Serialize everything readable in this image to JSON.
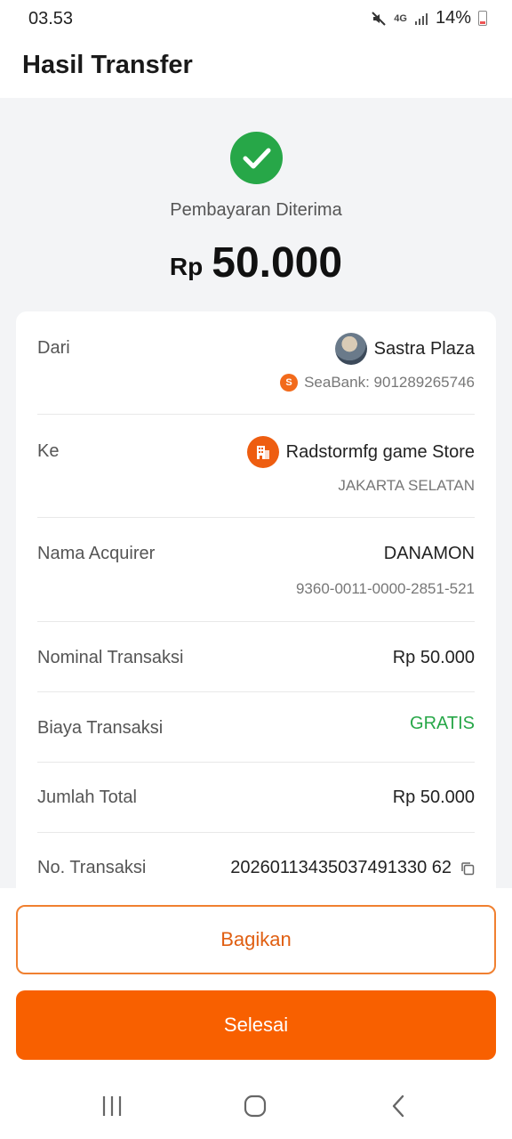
{
  "status_bar": {
    "time": "03.53",
    "network": "4G",
    "battery": "14%"
  },
  "header": {
    "title": "Hasil Transfer"
  },
  "result": {
    "status": "Pembayaran Diterima",
    "currency": "Rp",
    "amount": "50.000",
    "success_color": "#27a748"
  },
  "details": {
    "from": {
      "label": "Dari",
      "name": "Sastra Plaza",
      "account": "SeaBank: 901289265746"
    },
    "to": {
      "label": "Ke",
      "name": "Radstormfg game Store",
      "location": "JAKARTA SELATAN"
    },
    "acquirer": {
      "label": "Nama Acquirer",
      "name": "DANAMON",
      "id": "9360-0011-0000-2851-521"
    },
    "nominal": {
      "label": "Nominal Transaksi",
      "value": "Rp 50.000"
    },
    "fee": {
      "label": "Biaya Transaksi",
      "value": "GRATIS"
    },
    "total": {
      "label": "Jumlah Total",
      "value": "Rp 50.000"
    },
    "transaction_no": {
      "label": "No. Transaksi",
      "value": "20260113435037491330 62"
    }
  },
  "actions": {
    "share_label": "Bagikan",
    "done_label": "Selesai",
    "accent_color": "#f86000"
  }
}
